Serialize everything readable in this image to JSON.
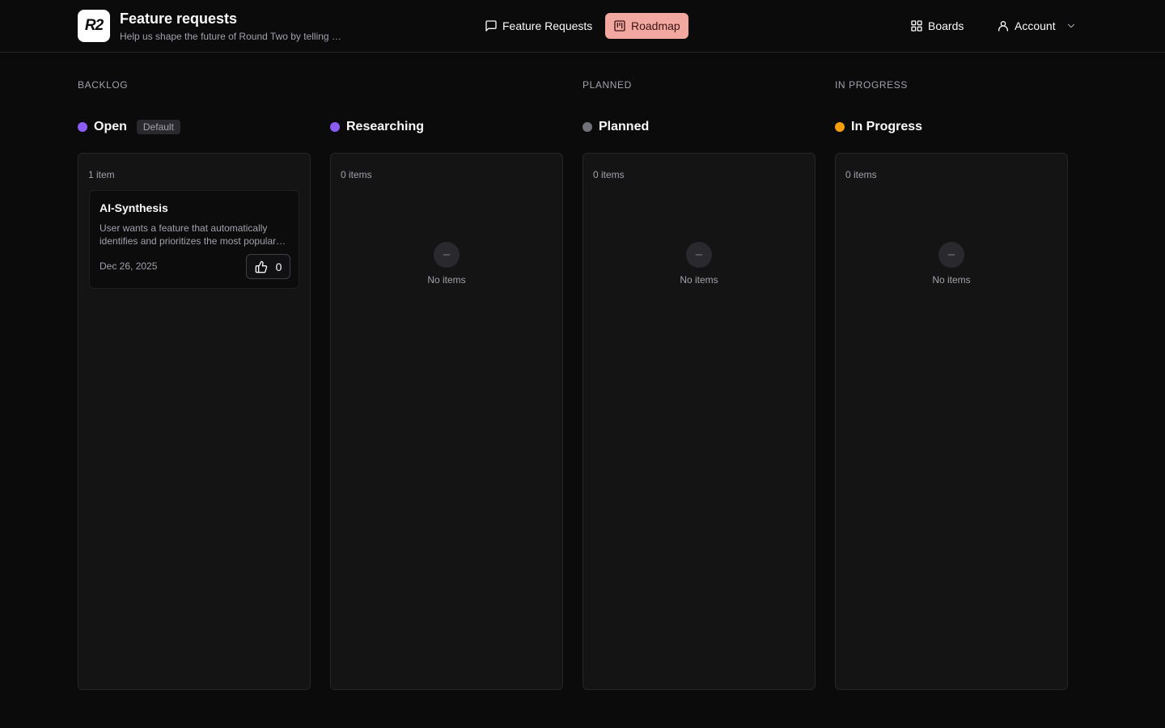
{
  "header": {
    "logo_text": "R2",
    "title": "Feature requests",
    "subtitle": "Help us shape the future of Round Two by telling us what features you want",
    "nav": {
      "feature_requests": "Feature Requests",
      "roadmap": "Roadmap",
      "boards": "Boards",
      "account": "Account"
    },
    "active_nav": "roadmap"
  },
  "sections": {
    "backlog": "BACKLOG",
    "planned": "PLANNED",
    "in_progress": "IN PROGRESS"
  },
  "columns": [
    {
      "title": "Open",
      "badge": "Default",
      "color": "#8b5cf6",
      "count": "1 item",
      "cards": [
        {
          "title": "AI-Synthesis",
          "description": "User wants a feature that automatically identifies and prioritizes the most popular feature requests",
          "date": "Dec 26, 2025",
          "votes": "0"
        }
      ]
    },
    {
      "title": "Researching",
      "color": "#8b5cf6",
      "count": "0 items",
      "empty_text": "No items"
    },
    {
      "title": "Planned",
      "color": "#71717a",
      "count": "0 items",
      "empty_text": "No items"
    },
    {
      "title": "In Progress",
      "color": "#f59e0b",
      "count": "0 items",
      "empty_text": "No items"
    }
  ],
  "colors": {
    "background": "#0b0b0c",
    "roadmap_active": "#f3a7a1",
    "column_bg": "#141415"
  }
}
